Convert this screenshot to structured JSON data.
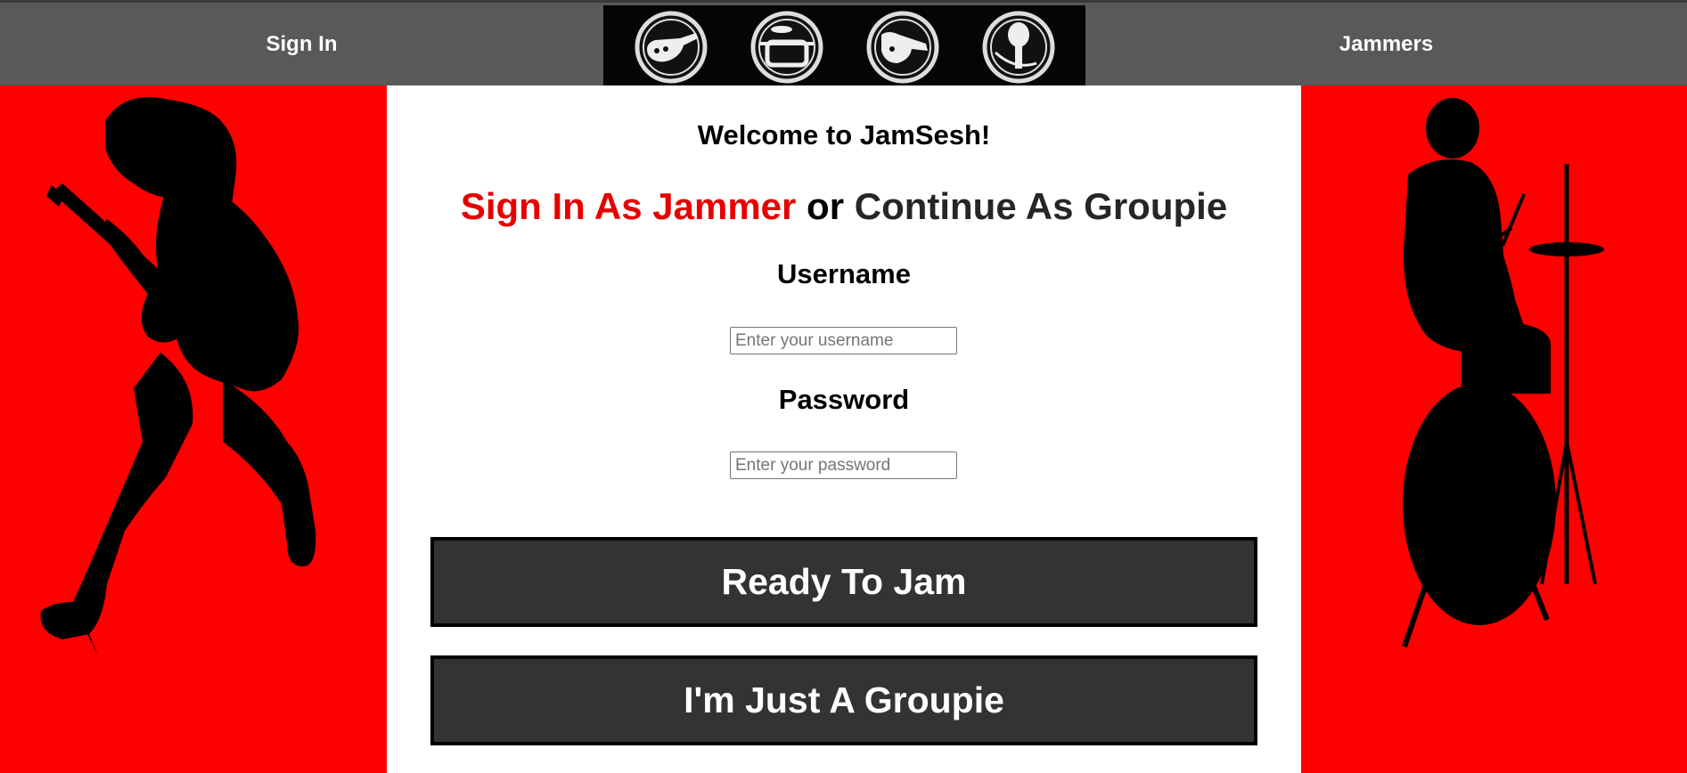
{
  "nav": {
    "sign_in": "Sign In",
    "jammers": "Jammers"
  },
  "logo": {
    "icons": [
      "bass-guitar-icon",
      "drum-icon",
      "electric-guitar-icon",
      "microphone-icon"
    ]
  },
  "main": {
    "welcome": "Welcome to JamSesh!",
    "choice": {
      "jammer": "Sign In As Jammer",
      "or": " or ",
      "groupie": "Continue As Groupie"
    },
    "username_label": "Username",
    "username_placeholder": "Enter your username",
    "username_value": "",
    "password_label": "Password",
    "password_placeholder": "Enter your password",
    "password_value": "",
    "ready_button": "Ready To Jam",
    "groupie_button": "I'm Just A Groupie"
  },
  "colors": {
    "side_panel": "#ff0000",
    "jammer_link": "#e60000",
    "nav_bar": "#595959",
    "button": "#333333"
  }
}
